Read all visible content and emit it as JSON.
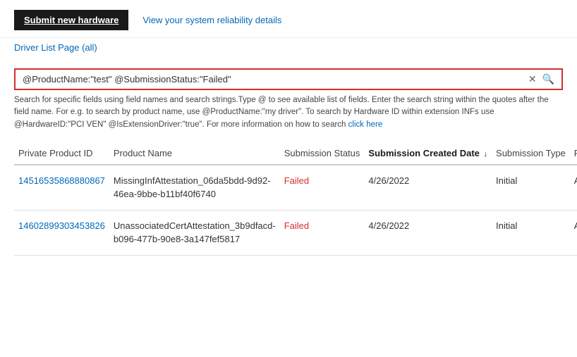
{
  "header": {
    "submit_button_label": "Submit new hardware",
    "reliability_link_label": "View your system reliability details",
    "driver_list_link_label": "Driver List Page (all)"
  },
  "search": {
    "value": "@ProductName:\"test\" @SubmissionStatus:\"Failed\"",
    "help_text": "Search for specific fields using field names and search strings.Type @ to see available list of fields. Enter the search string within the quotes after the field name. For e.g. to search by product name, use @ProductName:\"my driver\". To search by Hardware ID within extension INFs use @HardwareID:\"PCI VEN\" @IsExtensionDriver:\"true\". For more information on how to search",
    "help_link_label": "click here"
  },
  "table": {
    "columns": [
      {
        "key": "private_product_id",
        "label": "Private Product ID",
        "sorted": false
      },
      {
        "key": "product_name",
        "label": "Product Name",
        "sorted": false
      },
      {
        "key": "submission_status",
        "label": "Submission Status",
        "sorted": false
      },
      {
        "key": "submission_created_date",
        "label": "Submission Created Date",
        "sorted": true
      },
      {
        "key": "submission_type",
        "label": "Submission Type",
        "sorted": false
      },
      {
        "key": "permission",
        "label": "Permission",
        "sorted": false
      }
    ],
    "rows": [
      {
        "private_product_id": "14516535868880867",
        "product_name": "MissingInfAttestation_06da5bdd-9d92-46ea-9bbe-b11bf40f6740",
        "submission_status": "Failed",
        "submission_created_date": "4/26/2022",
        "submission_type": "Initial",
        "permission": "Author"
      },
      {
        "private_product_id": "14602899303453826",
        "product_name": "UnassociatedCertAttestation_3b9dfacd-b096-477b-90e8-3a147fef5817",
        "submission_status": "Failed",
        "submission_created_date": "4/26/2022",
        "submission_type": "Initial",
        "permission": "Author"
      }
    ]
  },
  "icons": {
    "clear": "✕",
    "search": "🔍",
    "sort_desc": "↓"
  }
}
